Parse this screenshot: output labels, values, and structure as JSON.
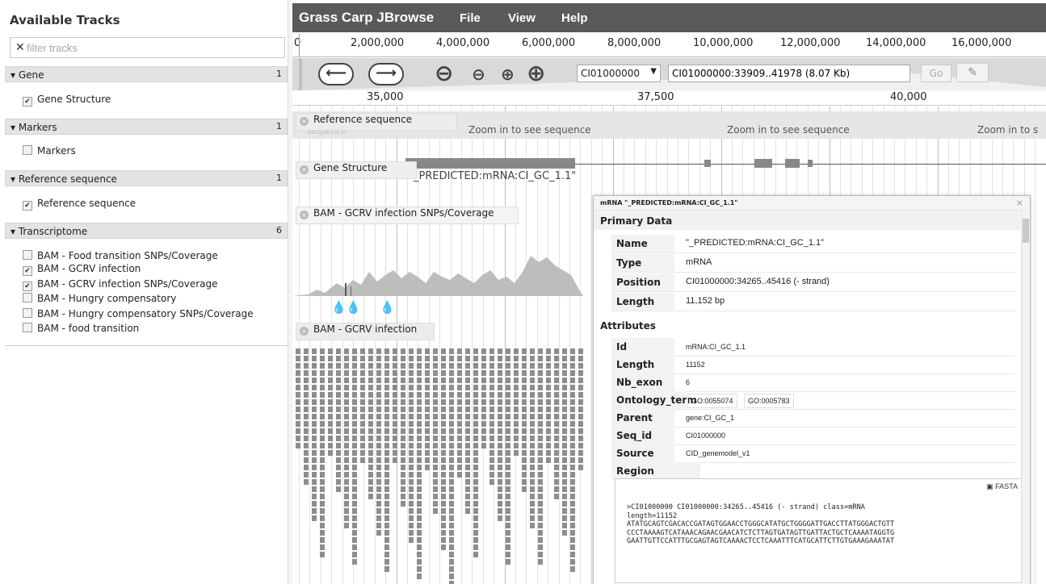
{
  "sidebar": {
    "title": "Available Tracks",
    "filter_placeholder": "filter tracks",
    "categories": [
      {
        "label": "Gene",
        "count": "1",
        "tracks": [
          {
            "label": "Gene Structure",
            "checked": true
          }
        ]
      },
      {
        "label": "Markers",
        "count": "1",
        "tracks": [
          {
            "label": "Markers",
            "checked": false
          }
        ]
      },
      {
        "label": "Reference sequence",
        "count": "1",
        "tracks": [
          {
            "label": "Reference sequence",
            "checked": true
          }
        ]
      },
      {
        "label": "Transcriptome",
        "count": "6",
        "tracks": [
          {
            "label": "BAM - Food transition SNPs/Coverage",
            "checked": false
          },
          {
            "label": "BAM - GCRV infection",
            "checked": true
          },
          {
            "label": "BAM - GCRV infection SNPs/Coverage",
            "checked": true
          },
          {
            "label": "BAM - Hungry compensatory",
            "checked": false
          },
          {
            "label": "BAM - Hungry compensatory SNPs/Coverage",
            "checked": false
          },
          {
            "label": "BAM - food transition",
            "checked": false
          }
        ]
      }
    ]
  },
  "menubar": {
    "app_title": "Grass Carp JBrowse",
    "file": "File",
    "view": "View",
    "help": "Help"
  },
  "overview_ruler": [
    "0",
    "2,000,000",
    "4,000,000",
    "6,000,000",
    "8,000,000",
    "10,000,000",
    "12,000,000",
    "14,000,000",
    "16,000,000"
  ],
  "toolbar": {
    "back_icon": "arrow-left-icon",
    "forward_icon": "arrow-right-icon",
    "ref_seq": "CI01000000",
    "location": "CI01000000:33909..41978 (8.07 Kb)",
    "go_label": "Go"
  },
  "detail_scale": [
    "35,000",
    "37,500",
    "40,000"
  ],
  "tracks": {
    "reference": {
      "label": "Reference sequence",
      "msg": "Zoom in to see sequence",
      "msg_cut": "Zoom in to s",
      "ghost": "sequence"
    },
    "gene": {
      "label": "Gene Structure",
      "feature_label": "_PREDICTED:mRNA:CI_GC_1.1\""
    },
    "snp": {
      "label": "BAM - GCRV infection SNPs/Coverage"
    },
    "bam": {
      "label": "BAM - GCRV infection"
    }
  },
  "popup": {
    "title": "mRNA \"_PREDICTED:mRNA:CI_GC_1.1\"",
    "primary_header": "Primary Data",
    "name_k": "Name",
    "name_v": "\"_PREDICTED:mRNA:CI_GC_1.1\"",
    "type_k": "Type",
    "type_v": "mRNA",
    "position_k": "Position",
    "position_v": "CI01000000:34265..45416 (- strand)",
    "length_k": "Length",
    "length_v": "11,152 bp",
    "attributes_header": "Attributes",
    "id_k": "Id",
    "id_v": "mRNA:CI_GC_1.1",
    "alen_k": "Length",
    "alen_v": "11152",
    "nbexon_k": "Nb_exon",
    "nbexon_v": "6",
    "ontology_k": "Ontology_term",
    "ontology_v1": "GO:0055074",
    "ontology_v2": "GO:0005783",
    "parent_k": "Parent",
    "parent_v": "gene:CI_GC_1",
    "seqid_k": "Seq_id",
    "seqid_v": "CI01000000",
    "source_k": "Source",
    "source_v": "CID_genemodel_v1",
    "region_header": "Region sequence",
    "fasta_button": "FASTA",
    "fasta_lines": [
      ">CI01000000 CI01000000:34265..45416 (- strand) class=mRNA",
      "length=11152",
      "ATATGCAGTCGACACCGATAGTGGAACCTGGGCATATGCTGGGGATTGACCTTATGGGACTGTT",
      "CCCTAAAAGTCATAAACAGAACGAACATCTCTTAGTGATAGTTGATTACTGCTCAAAATAGGTG",
      "GAATTGTTCCATTTGCGAGTAGTCAAAACTCCTCAAATTTCATGCATTCTTGTGAAAGAAATAT"
    ]
  }
}
